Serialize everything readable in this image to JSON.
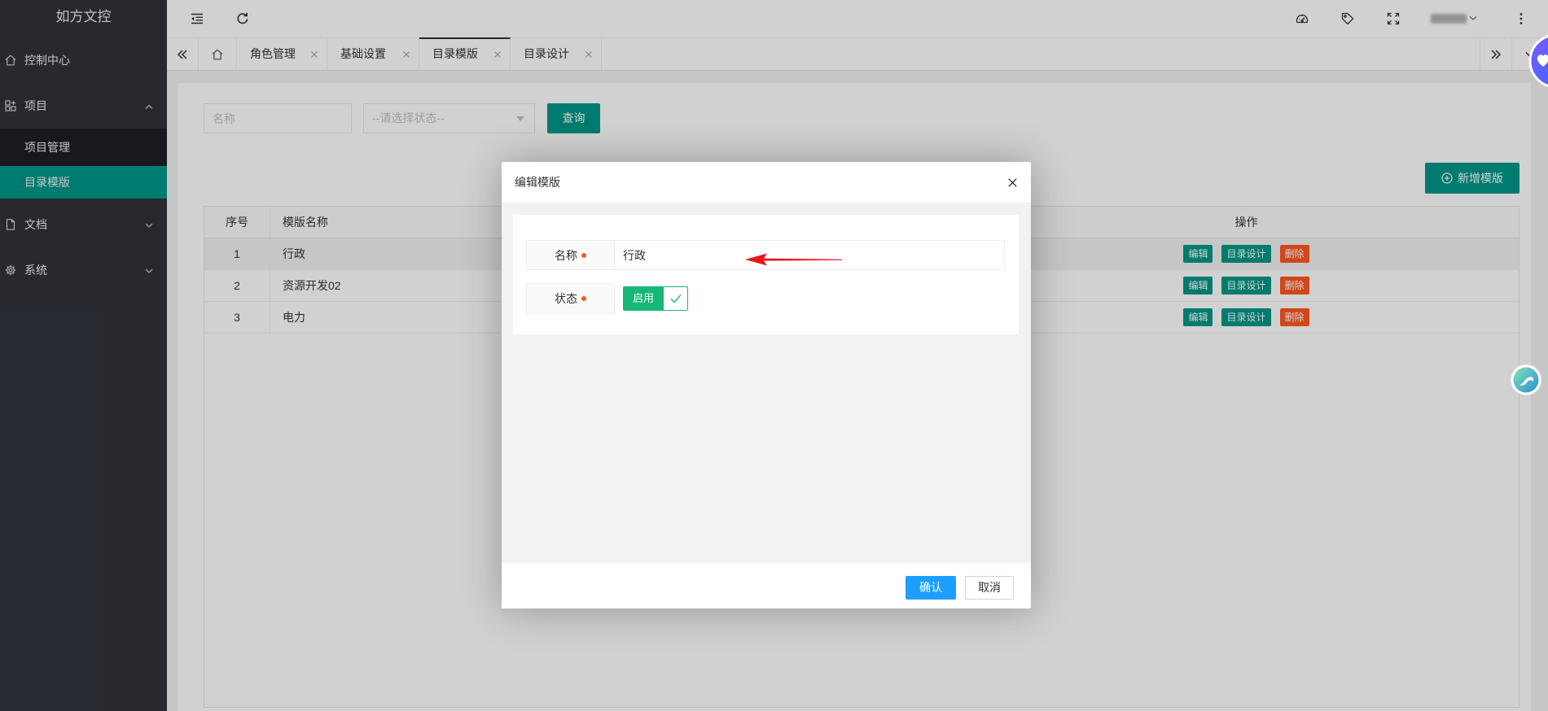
{
  "app": {
    "title": "如方文控"
  },
  "sidebar": {
    "items": [
      {
        "label": "控制中心",
        "icon": "home-icon"
      },
      {
        "label": "项目",
        "icon": "apps-icon",
        "expanded": true,
        "children": [
          {
            "label": "项目管理"
          },
          {
            "label": "目录模版",
            "active": true
          }
        ]
      },
      {
        "label": "文档",
        "icon": "document-icon",
        "expanded": false
      },
      {
        "label": "系统",
        "icon": "gear-icon",
        "expanded": false
      }
    ]
  },
  "header": {
    "icons": [
      "menu-fold-icon",
      "refresh-icon",
      "theme-icon",
      "tag-icon",
      "fullscreen-icon",
      "chevron-down-icon",
      "more-vertical-icon"
    ]
  },
  "tabs": {
    "items": [
      {
        "label": "角色管理"
      },
      {
        "label": "基础设置"
      },
      {
        "label": "目录模版",
        "active": true
      },
      {
        "label": "目录设计"
      }
    ]
  },
  "search": {
    "name_placeholder": "名称",
    "status_placeholder": "--请选择状态--",
    "query_label": "查询"
  },
  "toolbar": {
    "add_label": "新增模版"
  },
  "table": {
    "columns": {
      "index": "序号",
      "name": "模版名称",
      "actions": "操作"
    },
    "rows": [
      {
        "index": "1",
        "name": "行政"
      },
      {
        "index": "2",
        "name": "资源开发02"
      },
      {
        "index": "3",
        "name": "电力"
      }
    ],
    "action_labels": {
      "edit": "编辑",
      "design": "目录设计",
      "delete": "删除"
    }
  },
  "modal": {
    "title": "编辑模版",
    "name_label": "名称",
    "name_value": "行政",
    "status_label": "状态",
    "status_value": "启用",
    "status_checked": true,
    "confirm_label": "确认",
    "cancel_label": "取消"
  },
  "colors": {
    "primary": "#009688",
    "danger": "#ff5722",
    "confirm": "#1e9fff",
    "switch_on": "#16b777",
    "required_dot": "#ff5722",
    "annotation_arrow": "#e8161b",
    "sidebar_bg": "#30333a"
  }
}
